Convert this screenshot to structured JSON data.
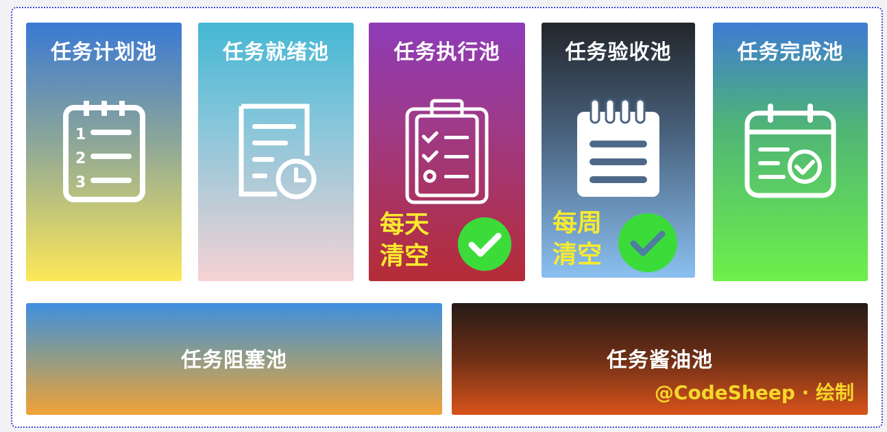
{
  "pools": [
    {
      "title": "任务计划池",
      "icon": "numbered-clipboard-icon"
    },
    {
      "title": "任务就绪池",
      "icon": "document-clock-icon"
    },
    {
      "title": "任务执行池",
      "icon": "checklist-clipboard-icon",
      "badge": {
        "line1": "每天",
        "line2": "清空"
      }
    },
    {
      "title": "任务验收池",
      "icon": "notepad-icon",
      "badge": {
        "line1": "每周",
        "line2": "清空"
      }
    },
    {
      "title": "任务完成池",
      "icon": "calendar-check-icon"
    }
  ],
  "bottom": [
    {
      "title": "任务阻塞池"
    },
    {
      "title": "任务酱油池"
    }
  ],
  "credit": "@CodeSheep · 绘制",
  "colors": {
    "badge_text": "#f9ea2e",
    "check_circle": "#3bdc3a",
    "frame_border": "#3a3fcf"
  }
}
